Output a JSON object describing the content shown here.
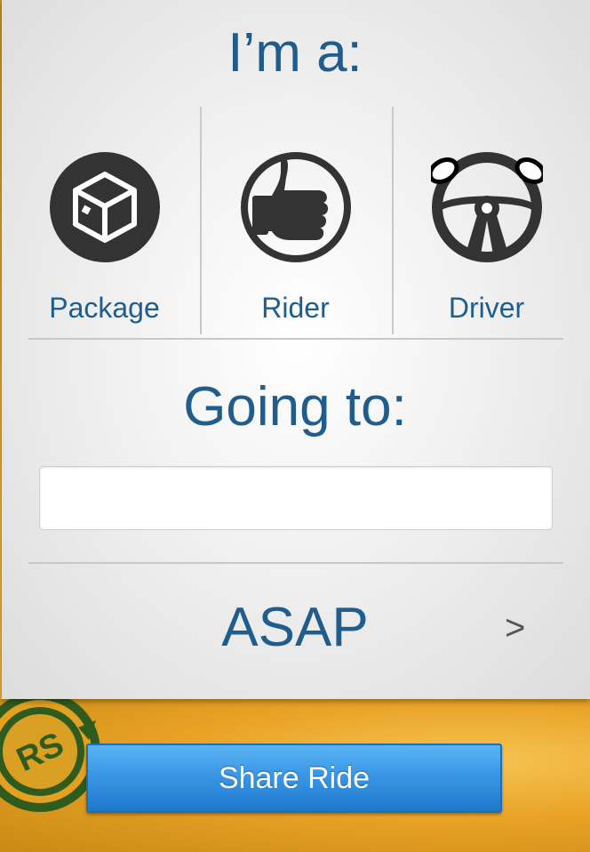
{
  "prompt": {
    "title": "I’m a:"
  },
  "roles": [
    {
      "label": "Package",
      "icon": "package-icon"
    },
    {
      "label": "Rider",
      "icon": "thumbs-up-icon"
    },
    {
      "label": "Driver",
      "icon": "steering-wheel-icon"
    }
  ],
  "destination": {
    "title": "Going to:",
    "value": "",
    "placeholder": ""
  },
  "time": {
    "value": "ASAP",
    "chevron": ">"
  },
  "actions": {
    "share_label": "Share Ride"
  },
  "brand": {
    "logo_text": "RS",
    "logo_icon": "ride-share-logo-icon"
  },
  "colors": {
    "accent_text": "#1f5d8e",
    "button_blue": "#3a97e6",
    "gold_background": "#e9a326",
    "icon_dark": "#333333"
  }
}
